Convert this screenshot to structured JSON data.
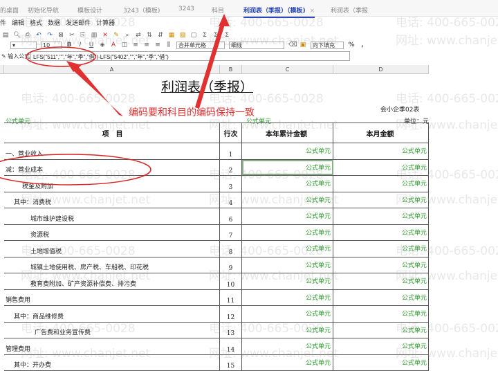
{
  "tabs": [
    {
      "label": "的桌面"
    },
    {
      "label": "初始化导航"
    },
    {
      "label": "模板设计"
    },
    {
      "label": "3243（模板)"
    },
    {
      "label": "3243"
    },
    {
      "label": "科目"
    },
    {
      "label": "利润表（季报）（模板)",
      "active": true,
      "close": "×"
    },
    {
      "label": "利润表（季报"
    }
  ],
  "menu": [
    "件",
    "编辑",
    "格式",
    "数据",
    "发送邮件",
    "计算器"
  ],
  "toolbar": {
    "font_size": "10",
    "merge": "合并单元格",
    "border": "细线",
    "fill": "向下填充",
    "percent": "%",
    "comma": ","
  },
  "formula": {
    "label": "输入公式:",
    "value": "LFS(\"511\",\"\",\"年\",\"季\",\"借\")-LFS(\"5402\",\"\",\"年\",\"季\",\"借\")"
  },
  "columns": [
    "A",
    "B",
    "C",
    "D"
  ],
  "report": {
    "title": "利润表（季报）",
    "form_no": "会小企季02表",
    "unit": "单位：元",
    "formula_cell": "公式单元"
  },
  "table": {
    "headers": [
      "项　目",
      "行次",
      "本年累计金额",
      "本月金额"
    ],
    "rows": [
      {
        "item": "一、营业收入",
        "no": "1",
        "indent": 0
      },
      {
        "item": "减：营业成本",
        "no": "2",
        "indent": 0
      },
      {
        "item": "税金及附加",
        "no": "3",
        "indent": 2
      },
      {
        "item": "其中：消费税",
        "no": "4",
        "indent": 1
      },
      {
        "item": "城市维护建设税",
        "no": "6",
        "indent": 3
      },
      {
        "item": "资源税",
        "no": "7",
        "indent": 3
      },
      {
        "item": "土地增值税",
        "no": "8",
        "indent": 3
      },
      {
        "item": "城镇土地使用税、房产税、车船税、印花税",
        "no": "9",
        "indent": 3
      },
      {
        "item": "教育费附加、矿产资源补偿费、排污费",
        "no": "10",
        "indent": 3
      },
      {
        "item": "销售费用",
        "no": "11",
        "indent": 0
      },
      {
        "item": "其中：商品维修费",
        "no": "12",
        "indent": 1
      },
      {
        "item": "广告费和业务宣传费",
        "no": "13",
        "indent": 3.5
      },
      {
        "item": "管理费用",
        "no": "14",
        "indent": 0
      },
      {
        "item": "其中：开办费",
        "no": "15",
        "indent": 1
      }
    ]
  },
  "annotation": {
    "text": "编码要和科目的编码保持一致",
    "color": "#e03030"
  },
  "watermark": {
    "phone": "电话: 400-665-0028",
    "site": "网址: www.chanjet.net"
  }
}
